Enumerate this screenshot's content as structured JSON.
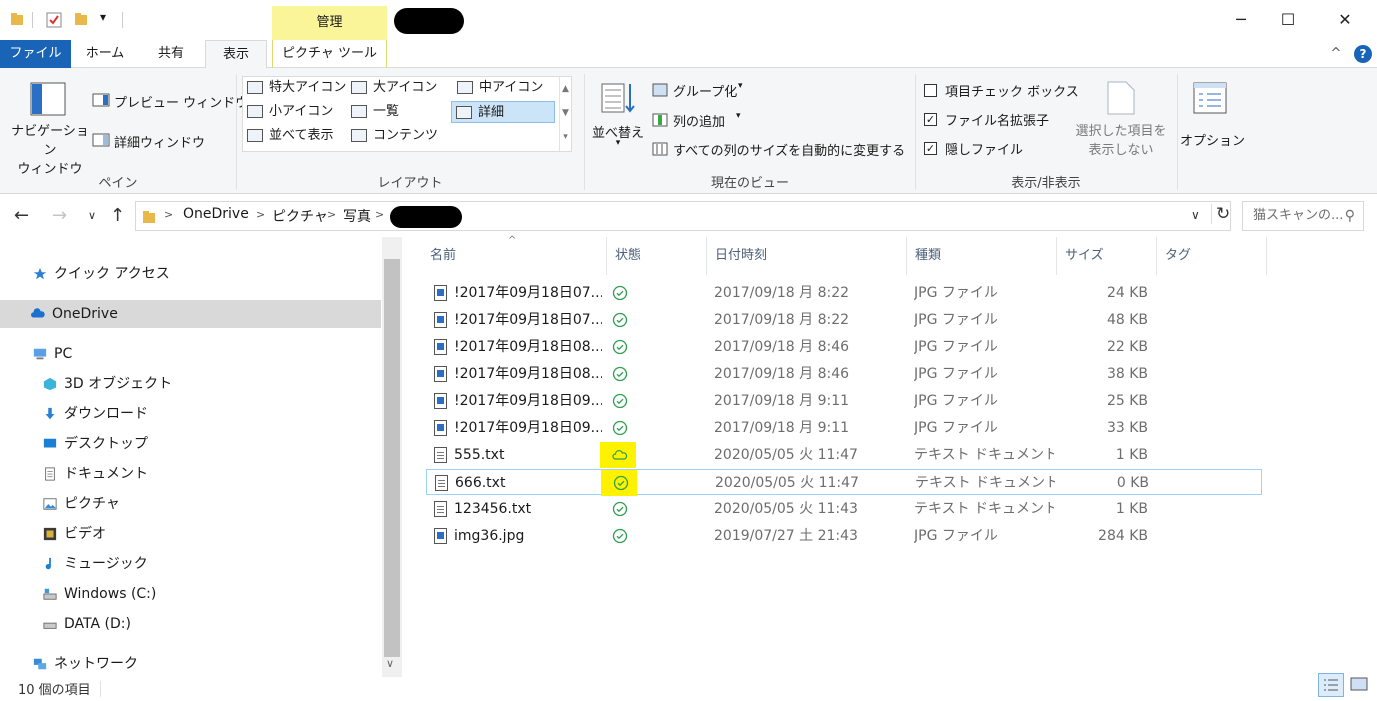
{
  "titlebar": {
    "manage_tab": "管理",
    "minimize": "─",
    "maximize": "☐",
    "close": "✕",
    "qat_dropdown": "▾"
  },
  "tabs": {
    "file": "ファイル",
    "home": "ホーム",
    "share": "共有",
    "view": "表示",
    "picture_tools": "ピクチャ ツール",
    "collapse": "^",
    "help": "?"
  },
  "ribbon": {
    "pane": {
      "navigation_pane": "ナビゲーション\nウィンドウ",
      "preview_pane": "プレビュー ウィンドウ",
      "details_pane": "詳細ウィンドウ",
      "label": "ペイン"
    },
    "layout": {
      "items": [
        "特大アイコン",
        "大アイコン",
        "中アイコン",
        "小アイコン",
        "一覧",
        "詳細",
        "並べて表示",
        "コンテンツ"
      ],
      "label": "レイアウト"
    },
    "current_view": {
      "sort": "並べ替え",
      "group_by": "グループ化",
      "add_columns": "列の追加",
      "size_all_columns": "すべての列のサイズを自動的に変更する",
      "label": "現在のビュー"
    },
    "show_hide": {
      "item_checkboxes": "項目チェック ボックス",
      "file_name_extensions": "ファイル名拡張子",
      "hidden_items": "隠しファイル",
      "hide_selected": "選択した項目を\n表示しない",
      "label": "表示/非表示"
    },
    "options": "オプション"
  },
  "address": {
    "crumbs": [
      "OneDrive",
      "ピクチャ",
      "写真"
    ],
    "search_placeholder": "猫スキャンの..."
  },
  "nav": {
    "items": [
      {
        "label": "クイック アクセス",
        "icon": "star-icon"
      },
      {
        "label": "OneDrive",
        "icon": "cloud-icon"
      },
      {
        "label": "PC",
        "icon": "pc-icon"
      },
      {
        "label": "3D オブジェクト",
        "icon": "3d-objects-icon"
      },
      {
        "label": "ダウンロード",
        "icon": "download-icon"
      },
      {
        "label": "デスクトップ",
        "icon": "desktop-icon"
      },
      {
        "label": "ドキュメント",
        "icon": "document-icon"
      },
      {
        "label": "ピクチャ",
        "icon": "pictures-icon"
      },
      {
        "label": "ビデオ",
        "icon": "video-icon"
      },
      {
        "label": "ミュージック",
        "icon": "music-icon"
      },
      {
        "label": "Windows (C:)",
        "icon": "drive-c-icon"
      },
      {
        "label": "DATA (D:)",
        "icon": "drive-d-icon"
      },
      {
        "label": "ネットワーク",
        "icon": "network-icon"
      }
    ]
  },
  "columns": {
    "name": "名前",
    "status": "状態",
    "date": "日付時刻",
    "type": "種類",
    "size": "サイズ",
    "tag": "タグ"
  },
  "files": [
    {
      "name": "!2017年09月18日07...",
      "status": "synced",
      "date": "2017/09/18 月 8:22",
      "type": "JPG ファイル",
      "size": "24 KB",
      "kind": "img"
    },
    {
      "name": "!2017年09月18日07...",
      "status": "synced",
      "date": "2017/09/18 月 8:22",
      "type": "JPG ファイル",
      "size": "48 KB",
      "kind": "img"
    },
    {
      "name": "!2017年09月18日08...",
      "status": "synced",
      "date": "2017/09/18 月 8:46",
      "type": "JPG ファイル",
      "size": "22 KB",
      "kind": "img"
    },
    {
      "name": "!2017年09月18日08...",
      "status": "synced",
      "date": "2017/09/18 月 8:46",
      "type": "JPG ファイル",
      "size": "38 KB",
      "kind": "img"
    },
    {
      "name": "!2017年09月18日09...",
      "status": "synced",
      "date": "2017/09/18 月 9:11",
      "type": "JPG ファイル",
      "size": "25 KB",
      "kind": "img"
    },
    {
      "name": "!2017年09月18日09...",
      "status": "synced",
      "date": "2017/09/18 月 9:11",
      "type": "JPG ファイル",
      "size": "33 KB",
      "kind": "img"
    },
    {
      "name": "555.txt",
      "status": "cloud",
      "date": "2020/05/05 火 11:47",
      "type": "テキスト ドキュメント",
      "size": "1 KB",
      "kind": "txt"
    },
    {
      "name": "666.txt",
      "status": "synced",
      "date": "2020/05/05 火 11:47",
      "type": "テキスト ドキュメント",
      "size": "0 KB",
      "kind": "txt"
    },
    {
      "name": "123456.txt",
      "status": "synced",
      "date": "2020/05/05 火 11:43",
      "type": "テキスト ドキュメント",
      "size": "1 KB",
      "kind": "txt"
    },
    {
      "name": "img36.jpg",
      "status": "synced",
      "date": "2019/07/27 土 21:43",
      "type": "JPG ファイル",
      "size": "284 KB",
      "kind": "img"
    }
  ],
  "statusbar": {
    "item_count": "10 個の項目"
  },
  "colors": {
    "accent": "#1a64b8",
    "contextual_tab": "#fbf59a",
    "highlight": "#fff200",
    "sync_green": "#2e9e4f",
    "selection": "#cce4f7"
  }
}
